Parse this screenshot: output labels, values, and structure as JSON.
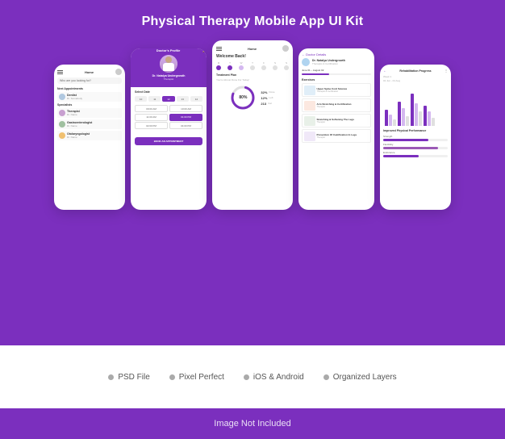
{
  "page": {
    "title": "Physical Therapy Mobile App UI Kit",
    "footer_text": "Image Not Included"
  },
  "features": [
    {
      "label": "PSD File",
      "color": "#aaaaaa"
    },
    {
      "label": "Pixel Perfect",
      "color": "#aaaaaa"
    },
    {
      "label": "iOS & Android",
      "color": "#aaaaaa"
    },
    {
      "label": "Organized Layers",
      "color": "#aaaaaa"
    }
  ],
  "phones": [
    {
      "id": "home",
      "screen": "home"
    },
    {
      "id": "doctor-profile",
      "screen": "doctor-profile"
    },
    {
      "id": "home-progress",
      "screen": "home-progress"
    },
    {
      "id": "doctor-details",
      "screen": "doctor-details"
    },
    {
      "id": "rehab-progress",
      "screen": "rehab-progress"
    }
  ],
  "colors": {
    "purple": "#7B2FBE",
    "light_purple": "#d4b8f0",
    "white": "#ffffff",
    "bg_purple": "#7B2FBE"
  }
}
